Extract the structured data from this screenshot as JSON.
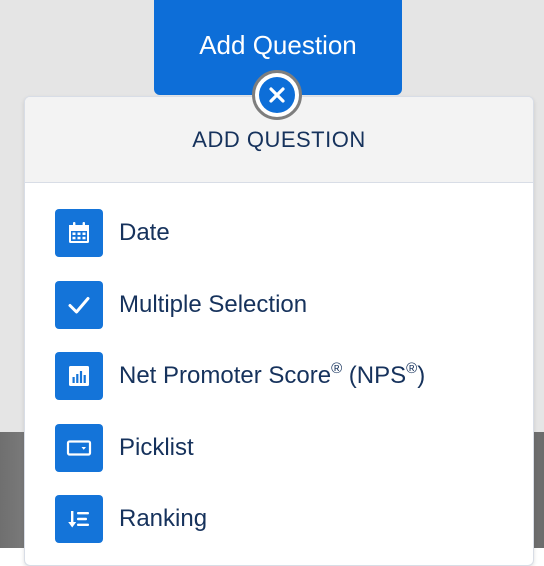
{
  "add_question_button": {
    "label": "Add Question"
  },
  "close_button": {
    "icon": "close-icon"
  },
  "popover": {
    "title": "ADD QUESTION",
    "items": [
      {
        "label": "Date",
        "icon": "calendar-icon"
      },
      {
        "label": "Multiple Selection",
        "icon": "checkmark-icon"
      },
      {
        "label": "Net Promoter Score",
        "sup1": "®",
        "label_mid": " (NPS",
        "sup2": "®",
        "label_end": ")",
        "icon": "bar-chart-icon"
      },
      {
        "label": "Picklist",
        "icon": "picklist-icon"
      },
      {
        "label": "Ranking",
        "icon": "ranking-icon"
      }
    ]
  },
  "colors": {
    "brand_blue": "#0d6ed8",
    "icon_blue": "#1474d9",
    "text_dark": "#16325c",
    "header_bg": "#f3f3f3"
  }
}
